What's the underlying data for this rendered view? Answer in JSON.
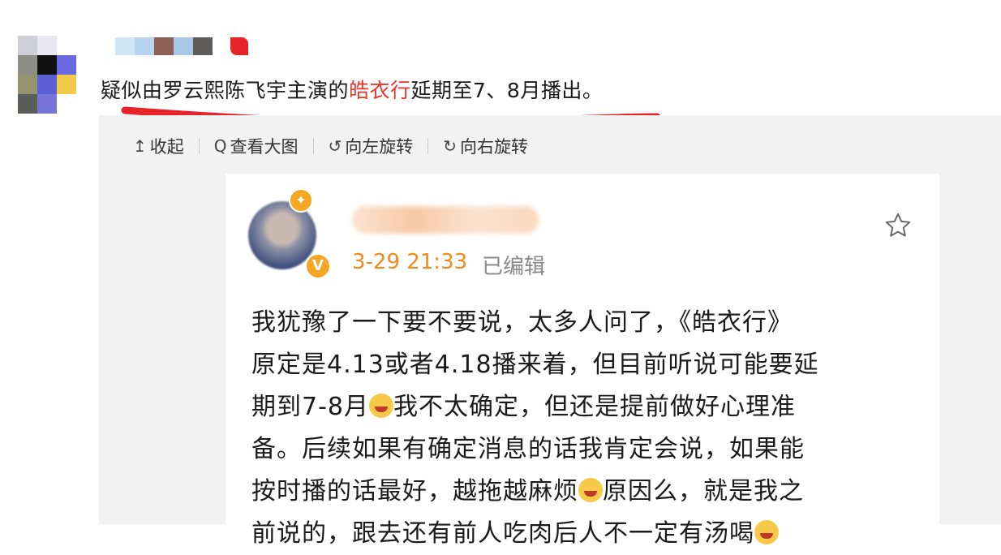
{
  "post": {
    "text_before": "疑似由罗云熙陈飞宇主演的",
    "text_highlight": "皓衣行",
    "text_after": "延期至7、8月播出。",
    "highlight_color": "#e8352c",
    "underline_color": "#e8242b"
  },
  "toolbar": {
    "collapse_icon": "↥",
    "collapse_label": "收起",
    "view_icon": "Q",
    "view_large_label": "查看大图",
    "rotate_left_icon": "↺",
    "rotate_left_label": "向左旋转",
    "rotate_right_icon": "↻",
    "rotate_right_label": "向右旋转"
  },
  "card": {
    "time": "3-29 21:33",
    "edited": "已编辑",
    "verify_badge": "V",
    "accent_color": "#f5a623",
    "lines": [
      "我犹豫了一下要不要说，太多人问了，《皓衣行》",
      "原定是4.13或者4.18播来着，但目前听说可能要延",
      "期到7-8月",
      "我不太确定，但还是提前做好心理准",
      "备。后续如果有确定消息的话我肯定会说，如果能",
      "按时播的话最好，越拖越麻烦",
      "原因么，就是我之",
      "前说的，跟去还有前人吃肉后人不一定有汤喝"
    ]
  }
}
